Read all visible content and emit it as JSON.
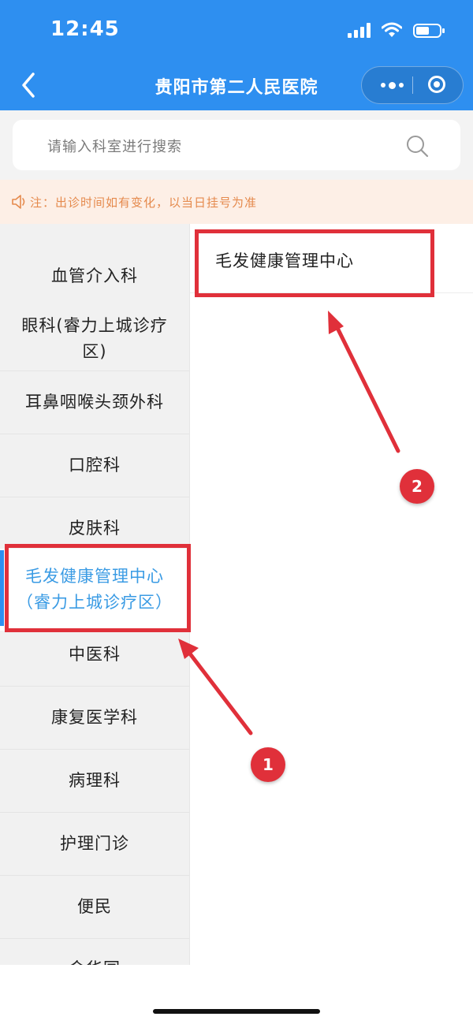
{
  "status_bar": {
    "time": "12:45"
  },
  "nav": {
    "title": "贵阳市第二人民医院"
  },
  "search": {
    "placeholder": "请输入科室进行搜索"
  },
  "notice": {
    "text": "注：出诊时间如有变化，以当日挂号为准"
  },
  "departments": [
    {
      "label": "血管介入科"
    },
    {
      "label": "眼科(睿力上城诊疗区)"
    },
    {
      "label": "耳鼻咽喉头颈外科"
    },
    {
      "label": "口腔科"
    },
    {
      "label": "皮肤科"
    },
    {
      "label": "毛发健康管理中心（睿力上城诊疗区）",
      "active": true
    },
    {
      "label": "中医科"
    },
    {
      "label": "康复医学科"
    },
    {
      "label": "病理科"
    },
    {
      "label": "护理门诊"
    },
    {
      "label": "便民"
    },
    {
      "label": "金华园"
    }
  ],
  "sub_departments": [
    {
      "label": "毛发健康管理中心"
    }
  ],
  "annotations": {
    "badge_1": "1",
    "badge_2": "2",
    "color": "#e0303a"
  },
  "theme": {
    "primary": "#2e8ff0",
    "active_text": "#3a9be4",
    "notice_text": "#e58a4d",
    "notice_bg": "#fdefe6"
  }
}
